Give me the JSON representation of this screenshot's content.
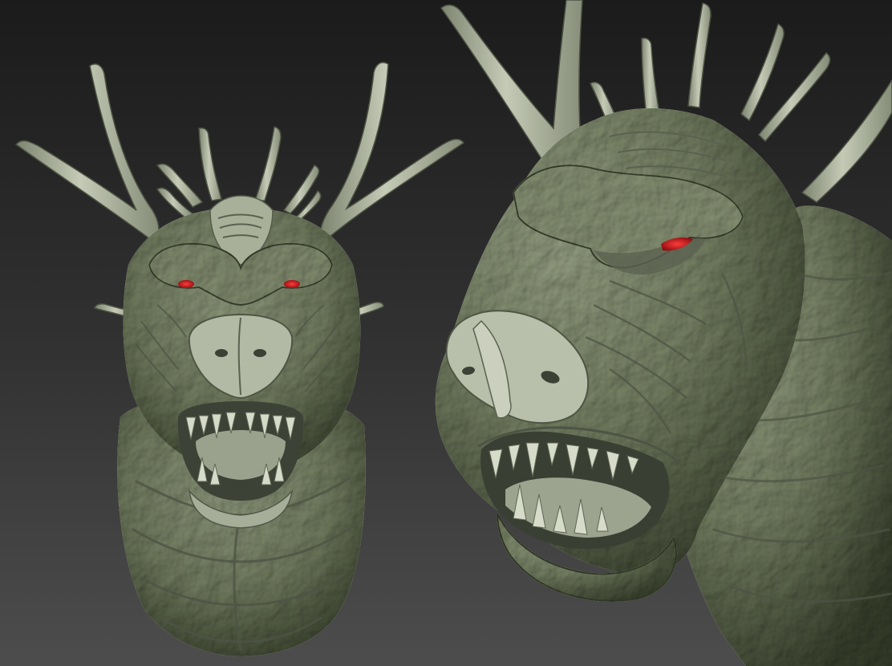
{
  "scene": {
    "colors": {
      "bg_top": "#1c1c1c",
      "bg_bottom": "#4c4c4c",
      "clay_light": "#c9cfbd",
      "clay_mid": "#9ea690",
      "clay_dark": "#5b6150",
      "clay_shadow": "#3a3f33",
      "eye": "#c8161b"
    },
    "views": [
      {
        "name": "front-view",
        "subject": "dragon-head-sculpt"
      },
      {
        "name": "three-quarter-view",
        "subject": "dragon-head-sculpt"
      }
    ]
  }
}
